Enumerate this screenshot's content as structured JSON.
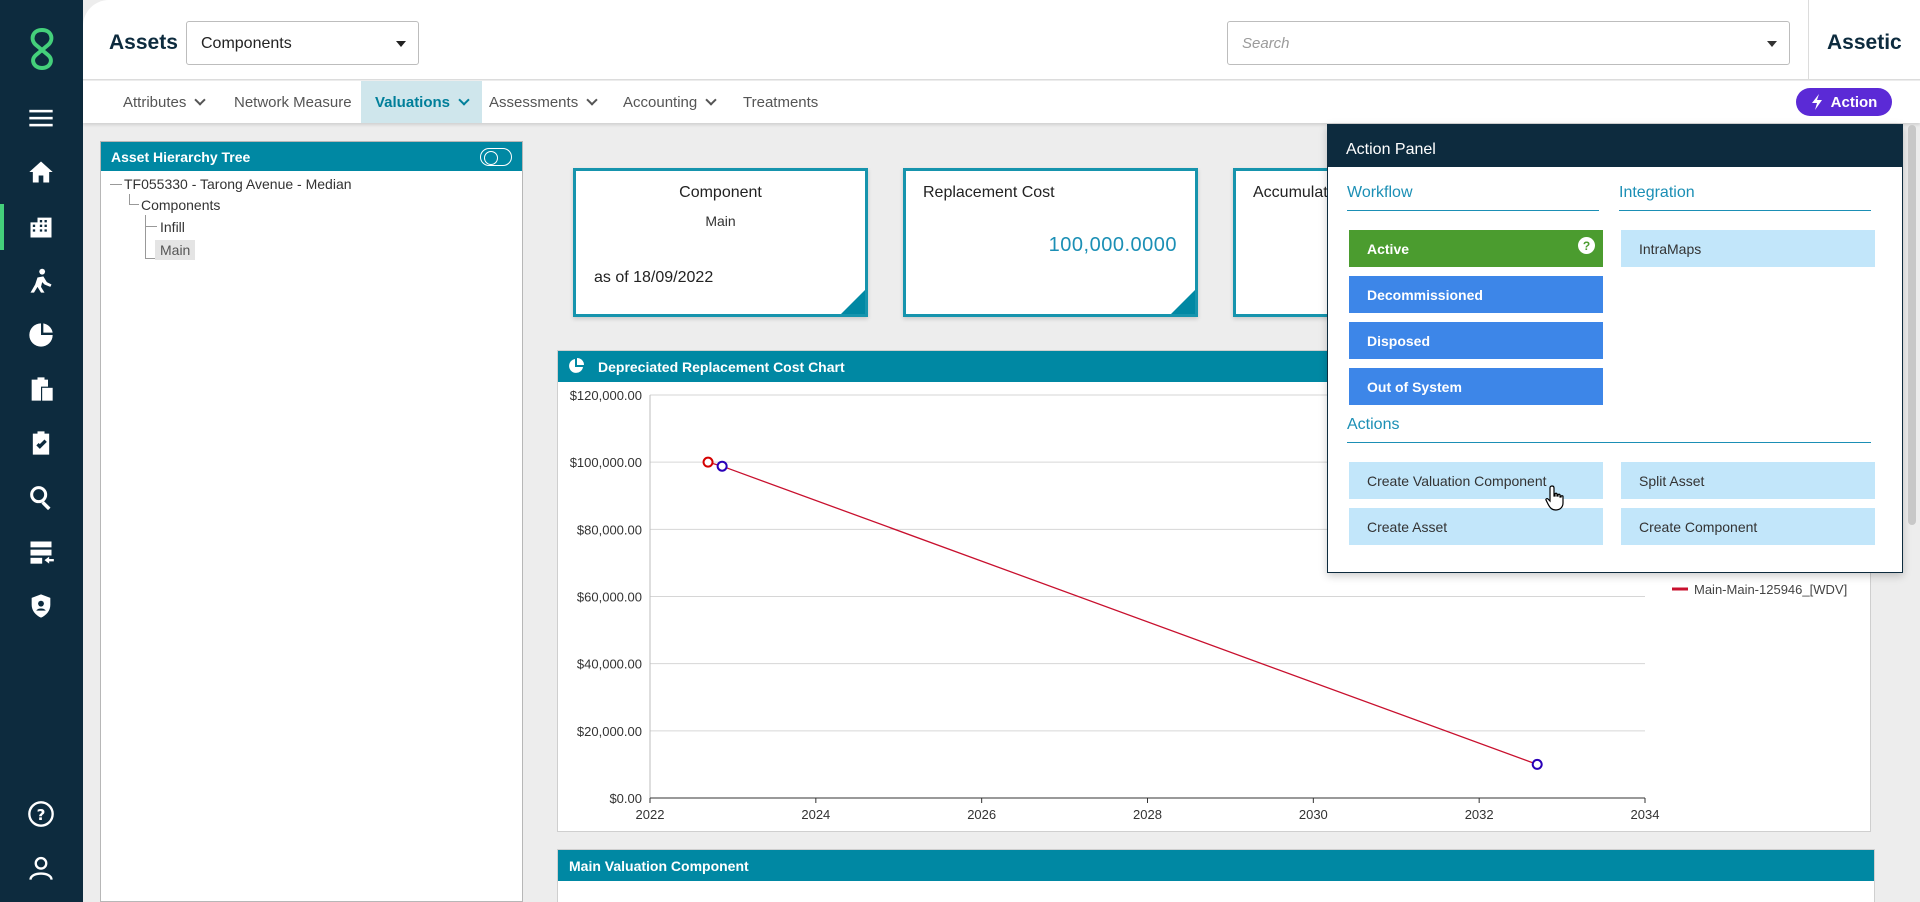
{
  "header": {
    "title": "Assets",
    "module_select": "Components",
    "search_placeholder": "Search",
    "brand": "Assetic"
  },
  "tabs": [
    {
      "label": "Attributes"
    },
    {
      "label": "Network Measure"
    },
    {
      "label": "Valuations"
    },
    {
      "label": "Assessments"
    },
    {
      "label": "Accounting"
    },
    {
      "label": "Treatments"
    }
  ],
  "action_button": "Action",
  "tree": {
    "title": "Asset Hierarchy Tree",
    "root": "TF055330 - Tarong Avenue - Median",
    "group": "Components",
    "children": [
      "Infill",
      "Main"
    ]
  },
  "cards": {
    "component": {
      "title": "Component",
      "value": "Main",
      "date": "as of 18/09/2022"
    },
    "replacement": {
      "title": "Replacement Cost",
      "value": "100,000.0000"
    },
    "accumulated": {
      "title": "Accumulat"
    }
  },
  "chart_panel": {
    "title": "Depreciated Replacement Cost Chart",
    "legend": "Main-Main-125946_[WDV]"
  },
  "chart_data": {
    "type": "line",
    "series": [
      {
        "name": "Main-Main-125946_[WDV]",
        "x": [
          2022.7,
          2022.87,
          2032.7
        ],
        "y": [
          100000,
          98800,
          10000
        ]
      }
    ],
    "ylim": [
      0,
      120000
    ],
    "xlim": [
      2022,
      2034
    ],
    "yticks": [
      "$0.00",
      "$20,000.00",
      "$40,000.00",
      "$60,000.00",
      "$80,000.00",
      "$100,000.00",
      "$120,000.00"
    ],
    "xticks": [
      "2022",
      "2024",
      "2026",
      "2028",
      "2030",
      "2032",
      "2034"
    ],
    "legend_position": "right",
    "grid": true,
    "colors": {
      "line": "#c8102e",
      "first_marker": "#d40000",
      "markers": "#2a00b8"
    }
  },
  "bottom_panel": {
    "title": "Main Valuation Component"
  },
  "action_panel": {
    "title": "Action Panel",
    "workflow_title": "Workflow",
    "integration_title": "Integration",
    "actions_title": "Actions",
    "workflow": [
      "Active",
      "Decommissioned",
      "Disposed",
      "Out of System"
    ],
    "integration": [
      "IntraMaps"
    ],
    "actions": [
      "Create Valuation Component",
      "Split Asset",
      "Create Asset",
      "Create Component"
    ],
    "help_glyph": "?"
  }
}
